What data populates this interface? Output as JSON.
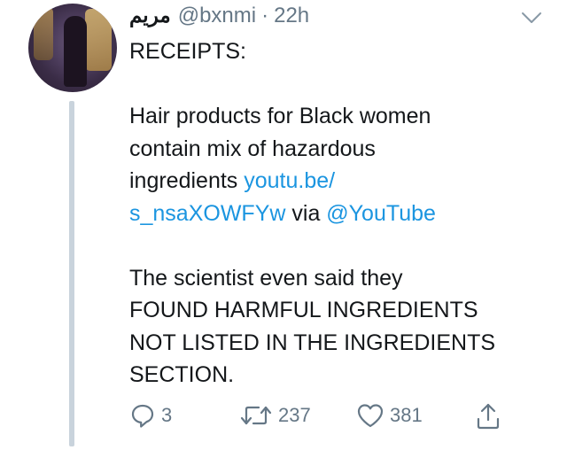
{
  "tweet": {
    "author": {
      "display_name": "مريم",
      "handle": "@bxnmi",
      "separator": "·",
      "timestamp": "22h"
    },
    "text": {
      "line1": "RECEIPTS:",
      "line2": "Hair products for Black women",
      "line3": "contain mix of hazardous",
      "line4_text": "ingredients ",
      "line4_link": "youtu.be/",
      "line5_link": "s_nsaXOWFYw",
      "line5_via": " via ",
      "line5_mention": "@YouTube",
      "line6": "The scientist even said they",
      "line7": "FOUND HARMFUL INGREDIENTS",
      "line8": "NOT LISTED IN THE INGREDIENTS",
      "line9": "SECTION."
    },
    "actions": {
      "reply_count": "3",
      "retweet_count": "237",
      "like_count": "381"
    }
  },
  "icons": {
    "menu": "chevron-down-icon",
    "reply": "reply-icon",
    "retweet": "retweet-icon",
    "like": "heart-icon",
    "share": "share-icon"
  },
  "colors": {
    "link": "#1b95e0",
    "secondary_text": "#657786",
    "thread_line": "#c9d3dc"
  }
}
